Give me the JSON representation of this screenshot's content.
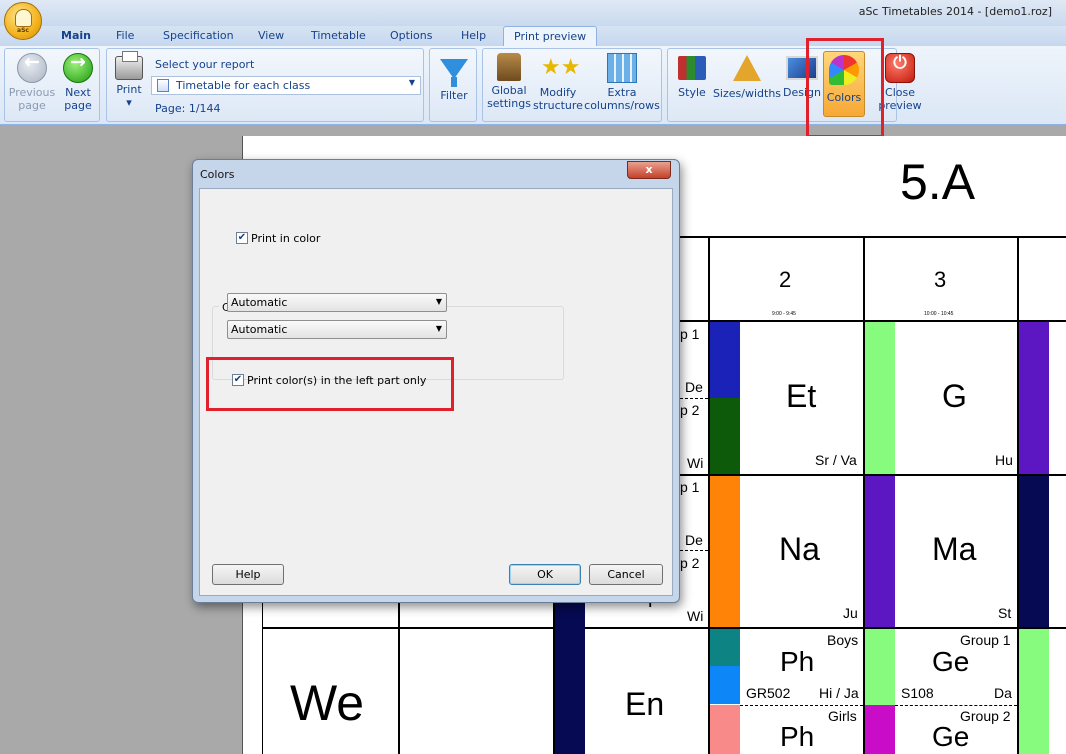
{
  "window": {
    "title": "aSc Timetables 2014  -  [demo1.roz]",
    "orb_text": "aSc"
  },
  "menu": {
    "tabs": [
      "Main",
      "File",
      "Specification",
      "View",
      "Timetable",
      "Options",
      "Help",
      "Print preview"
    ]
  },
  "ribbon": {
    "prev": [
      "Previous",
      "page"
    ],
    "next": [
      "Next",
      "page"
    ],
    "print": "Print",
    "print_arrow": "▾",
    "select_report_label": "Select your report",
    "report_value": "Timetable for each class",
    "page_label": "Page: 1/144",
    "filter": "Filter",
    "global": [
      "Global",
      "settings"
    ],
    "modify": [
      "Modify",
      "structure"
    ],
    "extra": [
      "Extra",
      "columns/rows"
    ],
    "style": "Style",
    "sizes": "Sizes/widths",
    "design": "Design",
    "colors": "Colors",
    "close": [
      "Close",
      "preview"
    ]
  },
  "timetable": {
    "class_name": "5.A",
    "periods": [
      {
        "num": "2",
        "time": "9:00 - 9:45"
      },
      {
        "num": "3",
        "time": "10:00 - 10:45"
      }
    ],
    "left_fragments": {
      "row1_top": "p 1",
      "row1_de": "De",
      "row1_mid": "p 2",
      "row1_wi": "Wi",
      "row2_top": "p 1",
      "row2_de": "De",
      "row2_mid": "p 2",
      "row2_wi": "Wi",
      "row2_bot": "p"
    },
    "row1": {
      "c2": {
        "subject": "Et",
        "teacher": "Sr / Va"
      },
      "c3": {
        "subject": "G",
        "teacher": "Hu"
      }
    },
    "row2": {
      "c2": {
        "subject": "Na",
        "teacher": "Ju"
      },
      "c3": {
        "subject": "Ma",
        "teacher": "St"
      }
    },
    "row3": {
      "day": "We",
      "c1": {
        "subject": "En"
      },
      "c2a": {
        "group": "Boys",
        "subject": "Ph",
        "room": "GR502",
        "teacher": "Hi / Ja"
      },
      "c2b": {
        "group": "Girls",
        "subject": "Ph"
      },
      "c3a": {
        "group": "Group 1",
        "subject": "Ge",
        "room": "S108",
        "teacher": "Da"
      },
      "c3b": {
        "group": "Group 2",
        "subject": "Ge"
      }
    },
    "colors": {
      "blue": "#1a22b8",
      "darkgreen": "#0e5a0b",
      "lightgreen": "#86fb7e",
      "purple": "#5c17c2",
      "navy": "#060a52",
      "orange": "#ff8306",
      "teal": "#0d8383",
      "skyblue": "#0d86f7",
      "pink": "#f98a8a",
      "magenta": "#c80cc8"
    }
  },
  "dialog": {
    "title": "Colors",
    "close_symbol": "x",
    "print_in_color": "Print in color",
    "print_in_color_checked": true,
    "color_group_label": "Color",
    "combo1": "Automatic",
    "combo2": "Automatic",
    "left_part_only": "Print color(s) in the left part only",
    "left_part_only_checked": true,
    "help": "Help",
    "ok": "OK",
    "cancel": "Cancel"
  }
}
